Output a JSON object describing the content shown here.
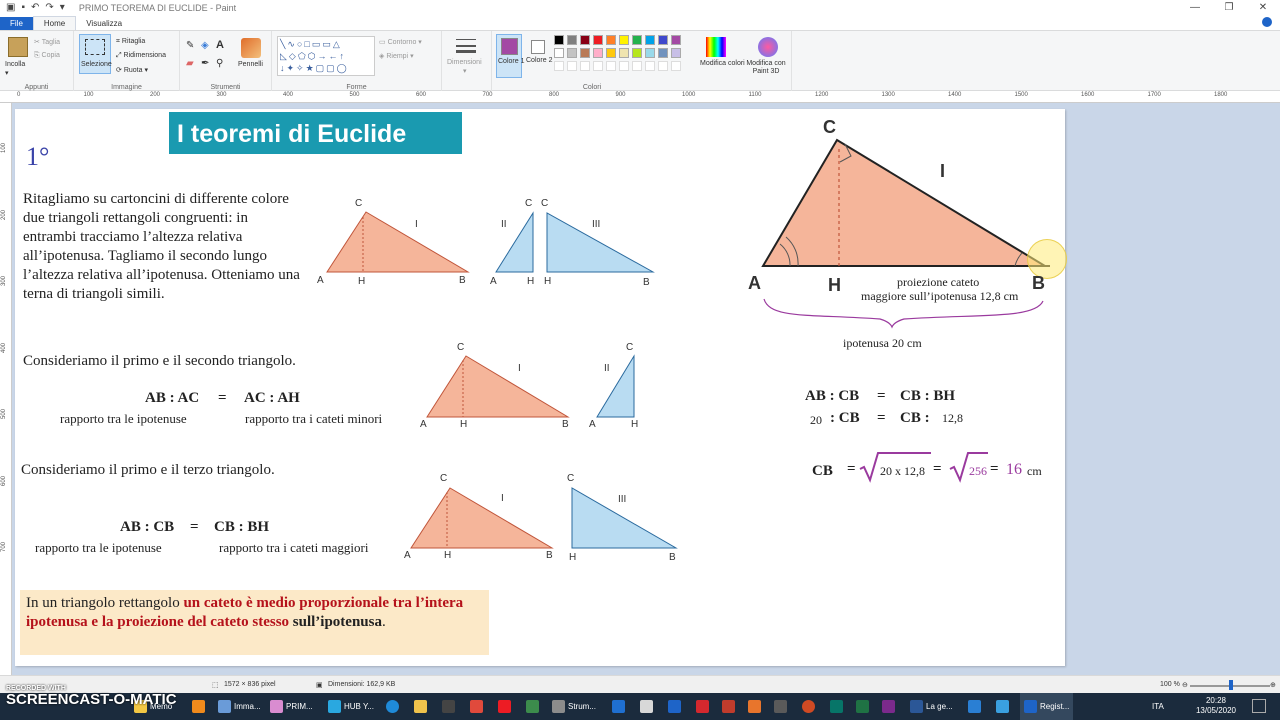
{
  "window": {
    "title": "PRIMO TEOREMA DI EUCLIDE - Paint"
  },
  "tabs": [
    "File",
    "Home",
    "Visualizza"
  ],
  "ribbon": {
    "appunti": {
      "label": "Appunti",
      "incolla": "Incolla",
      "taglia": "Taglia",
      "copia": "Copia"
    },
    "immagine": {
      "label": "Immagine",
      "selezione": "Selezione",
      "ritaglia": "Ritaglia",
      "ridimensiona": "Ridimensiona",
      "ruota": "Ruota"
    },
    "strumenti": {
      "label": "Strumenti",
      "pennelli": "Pennelli"
    },
    "forme": {
      "label": "Forme",
      "contorno": "Contorno",
      "riempi": "Riempi"
    },
    "dimensioni": "Dimensioni",
    "colori": {
      "label": "Colori",
      "colore1": "Colore 1",
      "colore2": "Colore 2",
      "modifica": "Modifica colori",
      "paint3d": "Modifica con Paint 3D"
    },
    "palette": [
      "#000000",
      "#7f7f7f",
      "#880015",
      "#ed1c24",
      "#ff7f27",
      "#fff200",
      "#22b14c",
      "#00a2e8",
      "#3f48cc",
      "#a349a4",
      "#ffffff",
      "#c3c3c3",
      "#b97a57",
      "#ffaec9",
      "#ffc90e",
      "#efe4b0",
      "#b5e61d",
      "#99d9ea",
      "#7092be",
      "#c8bfe7"
    ],
    "colore1_value": "#a349a4"
  },
  "ruler": {
    "h": [
      "0",
      "100",
      "200",
      "300",
      "400",
      "500",
      "600",
      "700",
      "800",
      "900",
      "1000",
      "1100",
      "1200",
      "1300",
      "1400",
      "1500",
      "1600",
      "1700",
      "1800"
    ],
    "v": [
      "100",
      "200",
      "300",
      "400",
      "500",
      "600",
      "700"
    ]
  },
  "doc": {
    "title": "I teoremi di Euclide",
    "numeral": "1°",
    "intro": "Ritagliamo su cartoncini di differente colore due triangoli rettangoli congruenti: in entrambi tracciamo l’altezza relativa all’ipotenusa. Tagliamo il secondo lungo l’altezza relativa all’ipotenusa. Otteniamo una terna di triangoli simili.",
    "section2": {
      "heading": "Consideriamo il primo e il secondo triangolo.",
      "formula_left": "AB : AC",
      "eq": "=",
      "formula_right": "AC : AH",
      "caption_left": "rapporto tra le ipotenuse",
      "caption_right": "rapporto tra i cateti minori"
    },
    "section3": {
      "heading": "Consideriamo il primo e il terzo triangolo.",
      "formula_left": "AB : CB",
      "eq": "=",
      "formula_right": "CB : BH",
      "caption_left": "rapporto tra le ipotenuse",
      "caption_right": "rapporto tra i cateti maggiori"
    },
    "highlight": {
      "p1": "In un triangolo rettangolo ",
      "p2": "un cateto è medio proporzionale tra l’intera ipotenusa e la proiezione del cateto stesso",
      "p3": "sull’ipotenusa",
      "p4": "."
    },
    "labels": {
      "A": "A",
      "B": "B",
      "C": "C",
      "H": "H",
      "I": "I",
      "II": "II",
      "III": "III"
    },
    "right": {
      "proiezione_l1": "proiezione cateto",
      "proiezione_l2": "maggiore sull’ipotenusa 12,8 cm",
      "ipotenusa": "ipotenusa 20 cm",
      "eq1_left": "AB : CB",
      "eq1_eq": "=",
      "eq1_right": "CB : BH",
      "eq2_num": "20",
      "eq2_mid": ": CB",
      "eq2_eq": "=",
      "eq2_cb": "CB :",
      "eq2_val": "12,8",
      "eq3_cb": "CB",
      "eq3_eq": "=",
      "eq3_rad1": "20 x 12,8",
      "eq3_eq2": "=",
      "eq3_rad2": "256",
      "eq3_eq3": "=",
      "eq3_res": "16",
      "eq3_unit": "cm"
    }
  },
  "status": {
    "size": "1572 × 836 pixel",
    "filesize": "Dimensioni: 162,9 KB",
    "zoom": "100 %"
  },
  "taskbar": {
    "items": [
      "Memo",
      "Imma...",
      "PRIM...",
      "HUB Y...",
      "Strum...",
      "La ge...",
      "Regist..."
    ],
    "lang": "ITA",
    "time": "20:28",
    "date": "13/05/2020"
  },
  "watermark": {
    "line1": "RECORDED WITH",
    "line2": "SCREENCAST-O-MATIC"
  }
}
